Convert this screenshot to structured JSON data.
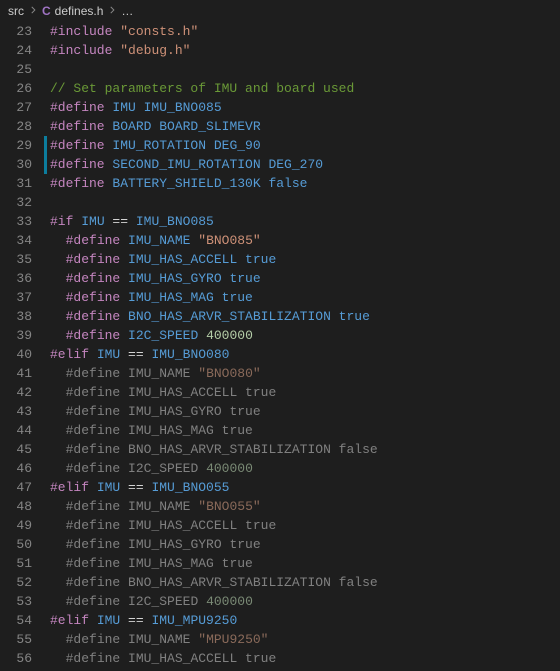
{
  "breadcrumb": {
    "folder": "src",
    "icon_label": "C",
    "file": "defines.h",
    "more": "…"
  },
  "lines": [
    {
      "n": 23,
      "tokens": [
        [
          "dir",
          "#include"
        ],
        [
          "op",
          " "
        ],
        [
          "str",
          "\"consts.h\""
        ]
      ]
    },
    {
      "n": 24,
      "tokens": [
        [
          "dir",
          "#include"
        ],
        [
          "op",
          " "
        ],
        [
          "str",
          "\"debug.h\""
        ]
      ]
    },
    {
      "n": 25,
      "tokens": []
    },
    {
      "n": 26,
      "tokens": [
        [
          "cmt",
          "// Set parameters of IMU and board used"
        ]
      ]
    },
    {
      "n": 27,
      "tokens": [
        [
          "dir",
          "#define"
        ],
        [
          "op",
          " "
        ],
        [
          "kw",
          "IMU IMU_BNO085"
        ]
      ]
    },
    {
      "n": 28,
      "tokens": [
        [
          "dir",
          "#define"
        ],
        [
          "op",
          " "
        ],
        [
          "kw",
          "BOARD BOARD_SLIMEVR"
        ]
      ]
    },
    {
      "n": 29,
      "modified": true,
      "tokens": [
        [
          "dir",
          "#define"
        ],
        [
          "op",
          " "
        ],
        [
          "kw",
          "IMU_ROTATION DEG_90"
        ]
      ]
    },
    {
      "n": 30,
      "modified": true,
      "tokens": [
        [
          "dir",
          "#define"
        ],
        [
          "op",
          " "
        ],
        [
          "kw",
          "SECOND_IMU_ROTATION DEG_270"
        ]
      ]
    },
    {
      "n": 31,
      "tokens": [
        [
          "dir",
          "#define"
        ],
        [
          "op",
          " "
        ],
        [
          "kw",
          "BATTERY_SHIELD_130K false"
        ]
      ]
    },
    {
      "n": 32,
      "tokens": []
    },
    {
      "n": 33,
      "tokens": [
        [
          "dir",
          "#if"
        ],
        [
          "op",
          " "
        ],
        [
          "kw",
          "IMU"
        ],
        [
          "op",
          " == "
        ],
        [
          "kw",
          "IMU_BNO085"
        ]
      ]
    },
    {
      "n": 34,
      "tokens": [
        [
          "op",
          "  "
        ],
        [
          "dir",
          "#define"
        ],
        [
          "op",
          " "
        ],
        [
          "kw",
          "IMU_NAME"
        ],
        [
          "op",
          " "
        ],
        [
          "str",
          "\"BNO085\""
        ]
      ]
    },
    {
      "n": 35,
      "tokens": [
        [
          "op",
          "  "
        ],
        [
          "dir",
          "#define"
        ],
        [
          "op",
          " "
        ],
        [
          "kw",
          "IMU_HAS_ACCELL true"
        ]
      ]
    },
    {
      "n": 36,
      "tokens": [
        [
          "op",
          "  "
        ],
        [
          "dir",
          "#define"
        ],
        [
          "op",
          " "
        ],
        [
          "kw",
          "IMU_HAS_GYRO true"
        ]
      ]
    },
    {
      "n": 37,
      "tokens": [
        [
          "op",
          "  "
        ],
        [
          "dir",
          "#define"
        ],
        [
          "op",
          " "
        ],
        [
          "kw",
          "IMU_HAS_MAG true"
        ]
      ]
    },
    {
      "n": 38,
      "tokens": [
        [
          "op",
          "  "
        ],
        [
          "dir",
          "#define"
        ],
        [
          "op",
          " "
        ],
        [
          "kw",
          "BNO_HAS_ARVR_STABILIZATION true"
        ]
      ]
    },
    {
      "n": 39,
      "tokens": [
        [
          "op",
          "  "
        ],
        [
          "dir",
          "#define"
        ],
        [
          "op",
          " "
        ],
        [
          "kw",
          "I2C_SPEED"
        ],
        [
          "op",
          " "
        ],
        [
          "num",
          "400000"
        ]
      ]
    },
    {
      "n": 40,
      "tokens": [
        [
          "dir",
          "#elif"
        ],
        [
          "op",
          " "
        ],
        [
          "kw",
          "IMU"
        ],
        [
          "op",
          " == "
        ],
        [
          "kw",
          "IMU_BNO080"
        ]
      ]
    },
    {
      "n": 41,
      "tokens": [
        [
          "op",
          "  "
        ],
        [
          "dim",
          "#define"
        ],
        [
          "op",
          " "
        ],
        [
          "dim",
          "IMU_NAME"
        ],
        [
          "op",
          " "
        ],
        [
          "dim-str",
          "\"BNO080\""
        ]
      ]
    },
    {
      "n": 42,
      "tokens": [
        [
          "op",
          "  "
        ],
        [
          "dim",
          "#define"
        ],
        [
          "op",
          " "
        ],
        [
          "dim",
          "IMU_HAS_ACCELL true"
        ]
      ]
    },
    {
      "n": 43,
      "tokens": [
        [
          "op",
          "  "
        ],
        [
          "dim",
          "#define"
        ],
        [
          "op",
          " "
        ],
        [
          "dim",
          "IMU_HAS_GYRO true"
        ]
      ]
    },
    {
      "n": 44,
      "tokens": [
        [
          "op",
          "  "
        ],
        [
          "dim",
          "#define"
        ],
        [
          "op",
          " "
        ],
        [
          "dim",
          "IMU_HAS_MAG true"
        ]
      ]
    },
    {
      "n": 45,
      "tokens": [
        [
          "op",
          "  "
        ],
        [
          "dim",
          "#define"
        ],
        [
          "op",
          " "
        ],
        [
          "dim",
          "BNO_HAS_ARVR_STABILIZATION false"
        ]
      ]
    },
    {
      "n": 46,
      "tokens": [
        [
          "op",
          "  "
        ],
        [
          "dim",
          "#define"
        ],
        [
          "op",
          " "
        ],
        [
          "dim",
          "I2C_SPEED"
        ],
        [
          "op",
          " "
        ],
        [
          "dim-num",
          "400000"
        ]
      ]
    },
    {
      "n": 47,
      "tokens": [
        [
          "dir",
          "#elif"
        ],
        [
          "op",
          " "
        ],
        [
          "kw",
          "IMU"
        ],
        [
          "op",
          " == "
        ],
        [
          "kw",
          "IMU_BNO055"
        ]
      ]
    },
    {
      "n": 48,
      "tokens": [
        [
          "op",
          "  "
        ],
        [
          "dim",
          "#define"
        ],
        [
          "op",
          " "
        ],
        [
          "dim",
          "IMU_NAME"
        ],
        [
          "op",
          " "
        ],
        [
          "dim-str",
          "\"BNO055\""
        ]
      ]
    },
    {
      "n": 49,
      "tokens": [
        [
          "op",
          "  "
        ],
        [
          "dim",
          "#define"
        ],
        [
          "op",
          " "
        ],
        [
          "dim",
          "IMU_HAS_ACCELL true"
        ]
      ]
    },
    {
      "n": 50,
      "tokens": [
        [
          "op",
          "  "
        ],
        [
          "dim",
          "#define"
        ],
        [
          "op",
          " "
        ],
        [
          "dim",
          "IMU_HAS_GYRO true"
        ]
      ]
    },
    {
      "n": 51,
      "tokens": [
        [
          "op",
          "  "
        ],
        [
          "dim",
          "#define"
        ],
        [
          "op",
          " "
        ],
        [
          "dim",
          "IMU_HAS_MAG true"
        ]
      ]
    },
    {
      "n": 52,
      "tokens": [
        [
          "op",
          "  "
        ],
        [
          "dim",
          "#define"
        ],
        [
          "op",
          " "
        ],
        [
          "dim",
          "BNO_HAS_ARVR_STABILIZATION false"
        ]
      ]
    },
    {
      "n": 53,
      "tokens": [
        [
          "op",
          "  "
        ],
        [
          "dim",
          "#define"
        ],
        [
          "op",
          " "
        ],
        [
          "dim",
          "I2C_SPEED"
        ],
        [
          "op",
          " "
        ],
        [
          "dim-num",
          "400000"
        ]
      ]
    },
    {
      "n": 54,
      "tokens": [
        [
          "dir",
          "#elif"
        ],
        [
          "op",
          " "
        ],
        [
          "kw",
          "IMU"
        ],
        [
          "op",
          " == "
        ],
        [
          "kw",
          "IMU_MPU9250"
        ]
      ]
    },
    {
      "n": 55,
      "tokens": [
        [
          "op",
          "  "
        ],
        [
          "dim",
          "#define"
        ],
        [
          "op",
          " "
        ],
        [
          "dim",
          "IMU_NAME"
        ],
        [
          "op",
          " "
        ],
        [
          "dim-str",
          "\"MPU9250\""
        ]
      ]
    },
    {
      "n": 56,
      "tokens": [
        [
          "op",
          "  "
        ],
        [
          "dim",
          "#define"
        ],
        [
          "op",
          " "
        ],
        [
          "dim",
          "IMU_HAS_ACCELL true"
        ]
      ]
    }
  ]
}
